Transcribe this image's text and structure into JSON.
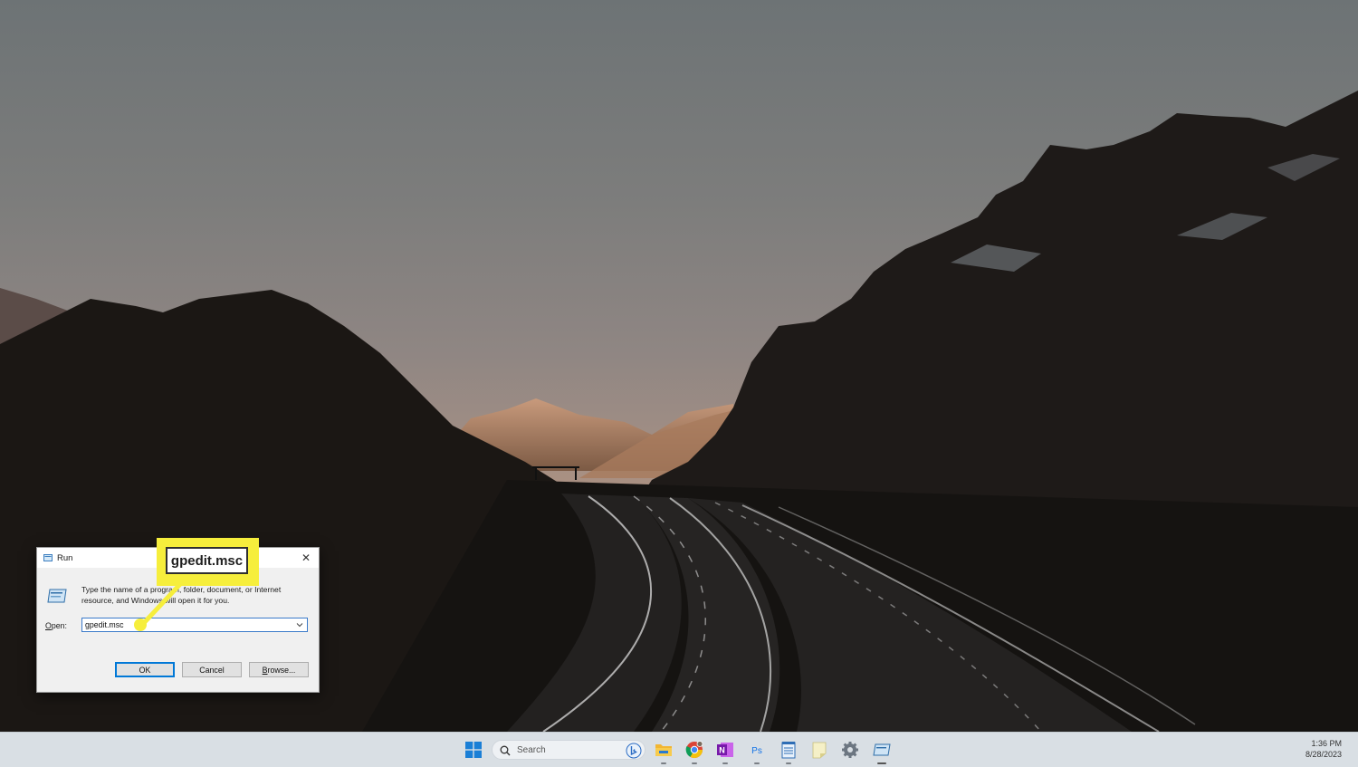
{
  "run_dialog": {
    "title": "Run",
    "description": "Type the name of a program, folder, document, or Internet resource, and Windows will open it for you.",
    "open_label_prefix": "",
    "open_label_mnemonic": "O",
    "open_label_rest": "pen:",
    "open_value": "gpedit.msc",
    "ok_label": "OK",
    "cancel_label": "Cancel",
    "browse_mnemonic": "B",
    "browse_rest": "rowse..."
  },
  "callout": {
    "text": "gpedit.msc",
    "color": "#f6ee3c"
  },
  "taskbar": {
    "search_placeholder": "Search",
    "apps": [
      "start-icon",
      "file-explorer-icon",
      "chrome-icon",
      "onenote-icon",
      "photoshop-icon",
      "notepad-icon",
      "sticky-notes-icon",
      "settings-icon",
      "run-icon"
    ],
    "photoshop_label": "Ps",
    "onenote_label": "N"
  },
  "clock": {
    "time": "1:36 PM",
    "date": "8/28/2023"
  }
}
